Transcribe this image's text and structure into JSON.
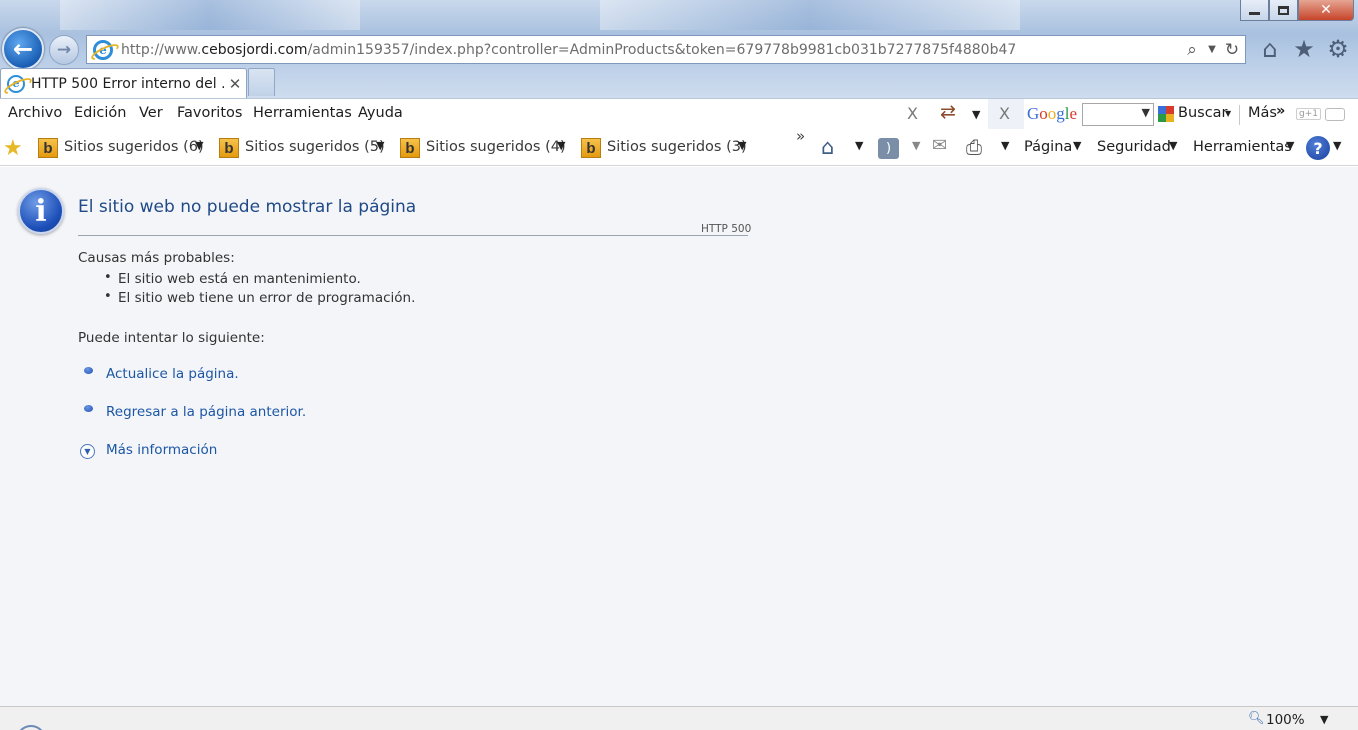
{
  "window": {
    "minimize": "minimize",
    "restore": "restore",
    "close_glyph": "✕"
  },
  "address_bar": {
    "url_prefix": "http://www.",
    "url_domain": "cebosjordi.com",
    "url_path": "/admin159357/index.php?controller=AdminProducts&token=679778b9981cb031b7277875f4880b47"
  },
  "tab": {
    "label": "HTTP 500 Error interno del ...",
    "close_glyph": "✕"
  },
  "menu": {
    "items": [
      "Archivo",
      "Edición",
      "Ver",
      "Favoritos",
      "Herramientas",
      "Ayuda"
    ],
    "x_glyph": "X",
    "google_letters": [
      "G",
      "o",
      "o",
      "g",
      "l",
      "e"
    ],
    "buscar": "Buscar",
    "mas": "Más",
    "gplus": "g+1"
  },
  "favorites": {
    "items": [
      "Sitios sugeridos (6)",
      "Sitios sugeridos (5)",
      "Sitios sugeridos (4)",
      "Sitios sugeridos (3)"
    ],
    "bing_glyph": "b",
    "overflow": "»"
  },
  "command_bar": {
    "page": "Página",
    "security": "Seguridad",
    "tools": "Herramientas",
    "help_glyph": "?"
  },
  "error_page": {
    "icon_glyph": "i",
    "title": "El sitio web no puede mostrar la página",
    "code": "HTTP 500",
    "causes_heading": "Causas más probables:",
    "causes": [
      "El sitio web está en mantenimiento.",
      "El sitio web tiene un error de programación."
    ],
    "try_heading": "Puede intentar lo siguiente:",
    "refresh_link": "Actualice la página.",
    "back_link": "Regresar a la página anterior.",
    "more_info": "Más información"
  },
  "status_bar": {
    "zoom": "100%"
  },
  "colors": {
    "title_blue": "#1f4a86",
    "link_blue": "#1c57a5",
    "content_bg": "#f4f5f9"
  }
}
